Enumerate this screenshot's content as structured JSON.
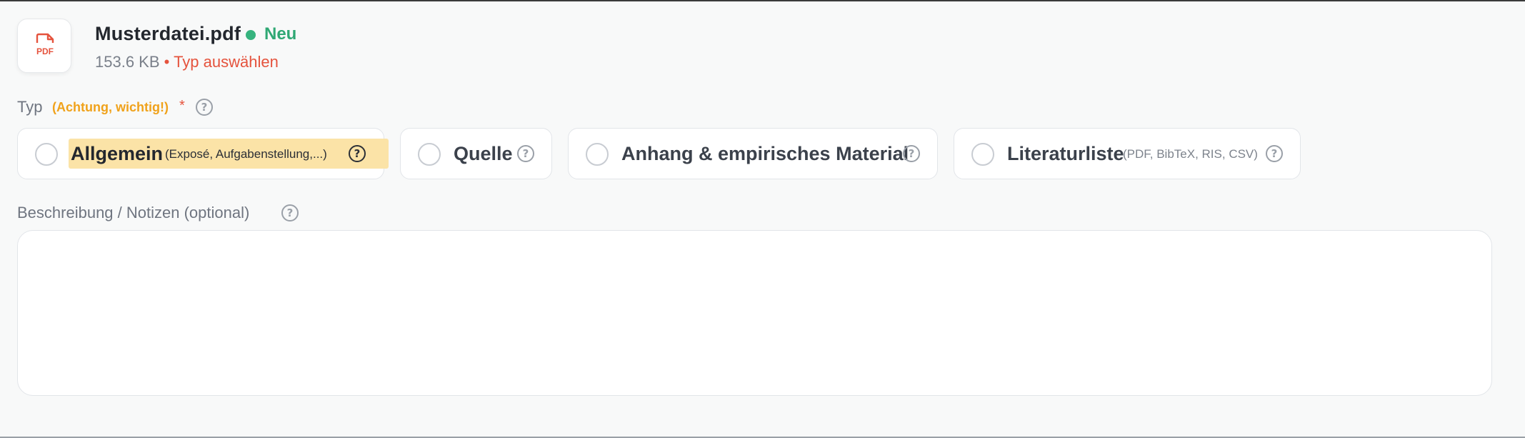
{
  "file": {
    "icon_text": "PDF",
    "name": "Musterdatei.pdf",
    "status": "Neu",
    "size": "153.6 KB",
    "separator": "•",
    "type_hint": "Typ auswählen"
  },
  "typ": {
    "label": "Typ",
    "note": "(Achtung, wichtig!)",
    "required_mark": "*",
    "options": [
      {
        "label": "Allgemein",
        "sub": "(Exposé, Aufgabenstellung,...)",
        "selected": false
      },
      {
        "label": "Quelle",
        "sub": ""
      },
      {
        "label": "Anhang & empirisches Material",
        "sub": ""
      },
      {
        "label": "Literaturliste",
        "sub": "(PDF, BibTeX, RIS, CSV)"
      }
    ]
  },
  "description": {
    "label": "Beschreibung / Notizen (optional)",
    "value": ""
  },
  "help_glyph": "?",
  "colors": {
    "accent_green": "#36b37e",
    "warning_red": "#e5533d",
    "note_orange": "#f0a21b",
    "highlight_yellow": "#fbe3a7"
  }
}
